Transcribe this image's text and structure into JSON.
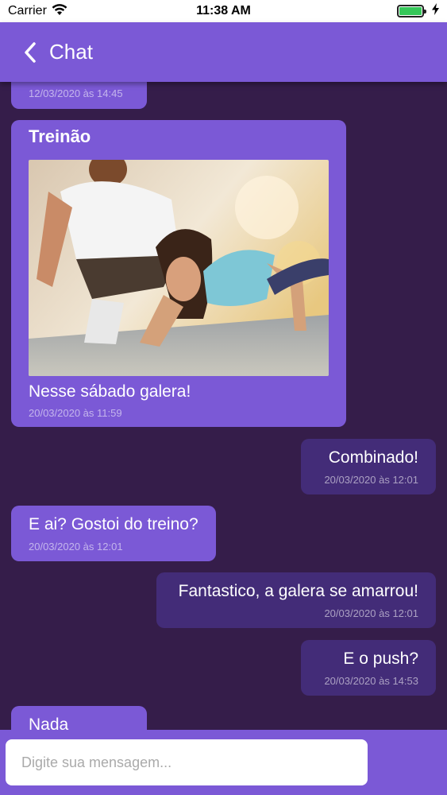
{
  "status_bar": {
    "carrier": "Carrier",
    "time": "11:38 AM"
  },
  "header": {
    "back_icon": "chevron-left-icon",
    "title": "Chat"
  },
  "messages": [
    {
      "type": "received",
      "text": "",
      "time": "12/03/2020 às 14:45"
    },
    {
      "type": "received",
      "title": "Treinão",
      "image": "workout-photo",
      "text": "Nesse sábado galera!",
      "time": "20/03/2020 às 11:59"
    },
    {
      "type": "sent",
      "text": "Combinado!",
      "time": "20/03/2020 às 12:01"
    },
    {
      "type": "received",
      "text": "E ai? Gostoi do treino?",
      "time": "20/03/2020 às 12:01"
    },
    {
      "type": "sent",
      "text": "Fantastico, a galera se amarrou!",
      "time": "20/03/2020 às 12:01"
    },
    {
      "type": "sent",
      "text": "E o push?",
      "time": "20/03/2020 às 14:53"
    },
    {
      "type": "received",
      "text": "Nada",
      "time": ""
    }
  ],
  "composer": {
    "placeholder": "Digite sua mensagem...",
    "value": ""
  },
  "colors": {
    "primary": "#7b59d6",
    "background": "#351d4a",
    "sent_bubble": "#432c78",
    "battery": "#35c759"
  }
}
